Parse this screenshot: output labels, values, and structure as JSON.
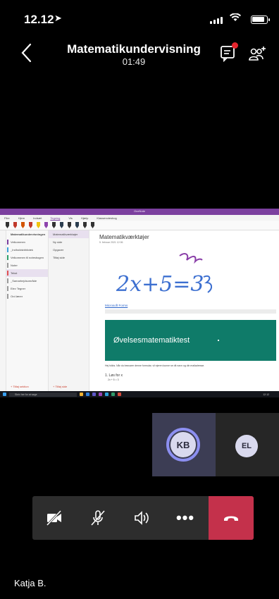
{
  "status_bar": {
    "time": "12.12",
    "location_glyph": "➤"
  },
  "call": {
    "title": "Matematikundervisning",
    "timer": "01:49"
  },
  "shared_screen": {
    "app_title": "OneNote",
    "menu": [
      "Filer",
      "Hjem",
      "Indsæt",
      "Tegning",
      "Vis",
      "Hjælp",
      "Klassenotesbog"
    ],
    "notebook_name": "Matematikundervisningen",
    "notebook_sections": [
      "Velkommen",
      "_Indholdsbibliotek",
      "Velkommen til notesbogen",
      "Noter",
      "Tekst",
      "_Samarbejdsområde",
      "Elev Tegner",
      "Ord lærer"
    ],
    "pages": [
      "Matematikværktøjer",
      "Ny side",
      "Opgaver",
      "Tilføj side"
    ],
    "page_title": "Matematikværktøjer",
    "page_date": "5. februar 2021   12:06",
    "handwriting": "2x+5=3",
    "link_text": "Microsoft Forms",
    "banner_title": "Øvelsesmatematiktest",
    "description": "Hej folkis. Når du besvarer denne formular, vil ejeren kunne se dit navn og din mailadresse.",
    "question_1": "1. Løs for x",
    "question_1_expr": "2x + 5 = 3",
    "footer_left": "+ Tilføj sektion",
    "footer_right": "+ Tilføj side",
    "taskbar_search": "Skriv her for at søge",
    "taskbar_clock": "12:12"
  },
  "participants": [
    {
      "initials": "KB",
      "speaking": true
    },
    {
      "initials": "EL",
      "speaking": false
    }
  ],
  "controls": {
    "camera": "camera-off-icon",
    "mic": "mic-off-icon",
    "speaker": "speaker-icon",
    "more": "•••",
    "hangup": "hang-up-icon"
  },
  "presenter_name": "Katja B.",
  "colors": {
    "onenote_purple": "#7b3f9e",
    "banner_teal": "#0f7b69",
    "hangup_red": "#c4314b",
    "speaker_ring": "#8c8ff0"
  }
}
